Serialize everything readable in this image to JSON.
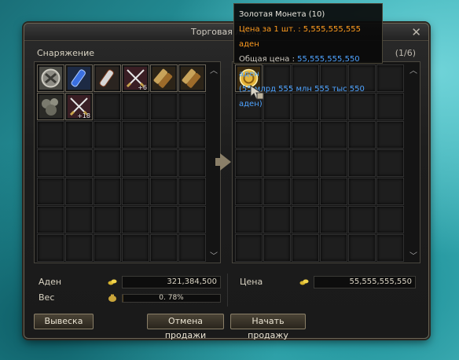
{
  "window": {
    "title": "Торговая лавка",
    "close_label": "✕",
    "equipment_label": "Снаряжение",
    "page_indicator": "(1/6)"
  },
  "inventory": {
    "items": [
      {
        "icon": "shield-emblem-icon",
        "count": ""
      },
      {
        "icon": "blue-potion-icon",
        "count": ""
      },
      {
        "icon": "silver-potion-icon",
        "count": ""
      },
      {
        "icon": "crossed-swords-icon",
        "count": "+6"
      },
      {
        "icon": "scroll-bundle-icon",
        "count": ""
      },
      {
        "icon": "scroll-bundle-icon",
        "count": ""
      },
      {
        "icon": "ore-icon",
        "count": ""
      },
      {
        "icon": "crossed-swords-icon",
        "count": "+18"
      }
    ]
  },
  "shop": {
    "items": [
      {
        "icon": "golden-coin-icon",
        "count": ""
      }
    ]
  },
  "tooltip": {
    "name": "Золотая Монета (10)",
    "price_line": "Цена за 1 шт. : 5,555,555,555 аден",
    "total_label": "Общая цена : ",
    "total_value": "55,555,555,550 аден",
    "total_words": "(55 млрд 555 млн 555 тыс 550 аден)"
  },
  "footer": {
    "adena_label": "Аден",
    "adena_value": "321,384,500",
    "weight_label": "Вес",
    "weight_value": "0. 78%",
    "weight_fraction": 0.0078,
    "price_label": "Цена",
    "price_value": "55,555,555,550"
  },
  "buttons": {
    "sign": "Вывеска",
    "cancel_sale": "Отмена продажи",
    "start_sale": "Начать продажу"
  },
  "colors": {
    "tooltip_price": "#ff9c1f",
    "tooltip_total": "#4ea3ff",
    "button_border": "#8a7f68"
  }
}
